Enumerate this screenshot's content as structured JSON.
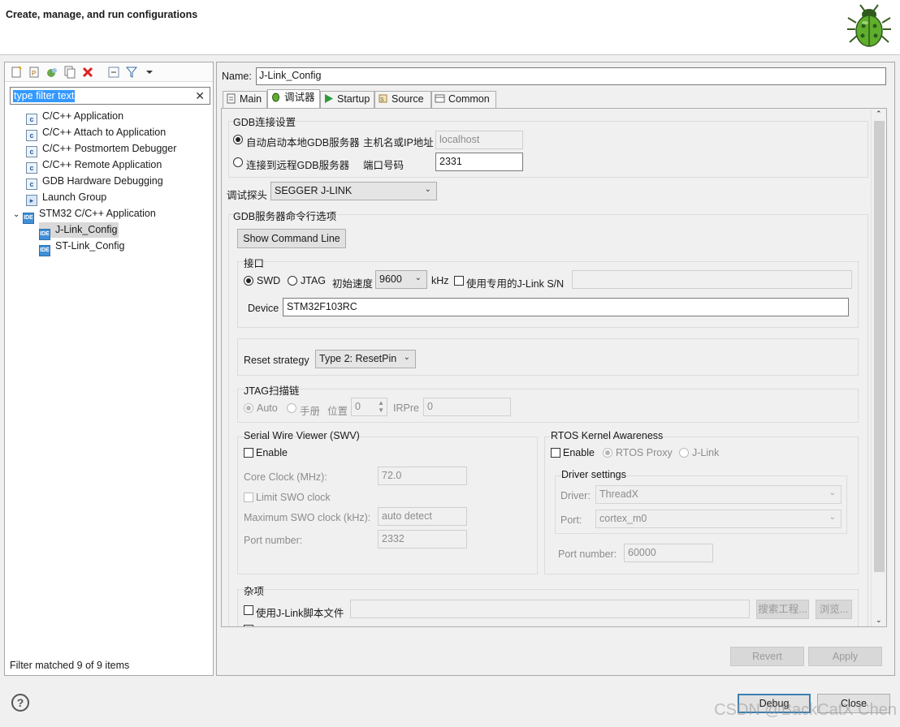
{
  "header": {
    "title": "Create, manage, and run configurations"
  },
  "left": {
    "filter": {
      "placeholder": "type filter text"
    },
    "tree": [
      {
        "label": "C/C++ Application"
      },
      {
        "label": "C/C++ Attach to Application"
      },
      {
        "label": "C/C++ Postmortem Debugger"
      },
      {
        "label": "C/C++ Remote Application"
      },
      {
        "label": "GDB Hardware Debugging"
      },
      {
        "label": "Launch Group"
      },
      {
        "label": "STM32 C/C++ Application"
      },
      {
        "label": "J-Link_Config"
      },
      {
        "label": "ST-Link_Config"
      }
    ],
    "status": "Filter matched 9 of 9 items"
  },
  "right": {
    "name_label": "Name:",
    "name_value": "J-Link_Config",
    "tabs": [
      {
        "label": "Main"
      },
      {
        "label": "调试器"
      },
      {
        "label": "Startup"
      },
      {
        "label": "Source"
      },
      {
        "label": "Common"
      }
    ],
    "gdb": {
      "title": "GDB连接设置",
      "auto_label": "自动启动本地GDB服务器",
      "host_label": "主机名或IP地址",
      "host_value": "localhost",
      "remote_label": "连接到远程GDB服务器",
      "port_label": "端口号码",
      "port_value": "2331"
    },
    "probe_label": "调试探头",
    "probe_value": "SEGGER J-LINK",
    "server_title": "GDB服务器命令行选项",
    "show_cmd": "Show Command Line",
    "iface": {
      "title": "接口",
      "swd": "SWD",
      "jtag": "JTAG",
      "speed_label": "初始速度",
      "speed_value": "9600",
      "khz": "kHz",
      "sn_label": "使用专用的J-Link S/N",
      "device_label": "Device",
      "device_value": "STM32F103RC"
    },
    "reset_label": "Reset strategy",
    "reset_value": "Type 2: ResetPin",
    "jtag_chain": {
      "title": "JTAG扫描链",
      "auto": "Auto",
      "manual": "手册",
      "pos_label": "位置",
      "pos_value": "0",
      "irpre_label": "IRPre",
      "irpre_value": "0"
    },
    "swv": {
      "title": "Serial Wire Viewer (SWV)",
      "enable": "Enable",
      "core_clock_label": "Core Clock (MHz):",
      "core_clock_value": "72.0",
      "limit": "Limit SWO clock",
      "max_label": "Maximum SWO clock (kHz):",
      "max_value": "auto detect",
      "port_label": "Port number:",
      "port_value": "2332"
    },
    "rtos": {
      "title": "RTOS Kernel Awareness",
      "enable": "Enable",
      "proxy": "RTOS Proxy",
      "jlink": "J-Link",
      "driver_settings": "Driver settings",
      "driver_label": "Driver:",
      "driver_value": "ThreadX",
      "port_label": "Port:",
      "port_value": "cortex_m0",
      "portnum_label": "Port number:",
      "portnum_value": "60000"
    },
    "misc": {
      "title": "杂项",
      "script_label": "使用J-Link脚本文件",
      "search_btn": "搜索工程...",
      "browse_btn": "浏览..."
    },
    "revert": "Revert",
    "apply": "Apply"
  },
  "footer": {
    "debug": "Debug",
    "close": "Close",
    "watermark": "CSDN @BackCatX Chen"
  }
}
